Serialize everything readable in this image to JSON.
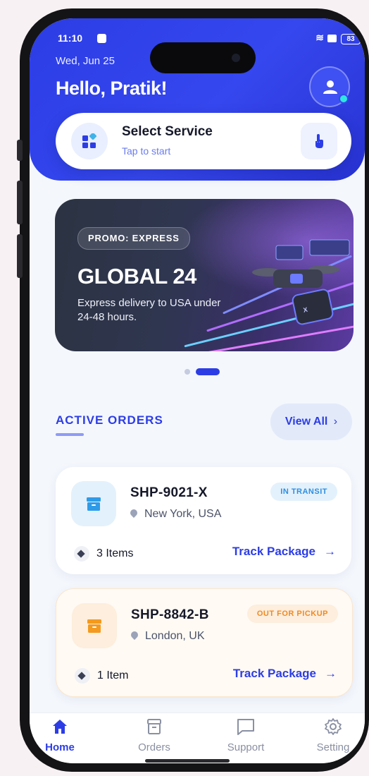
{
  "status_bar": {
    "time": "11:10",
    "battery": "83"
  },
  "header": {
    "date": "Wed, Jun 25",
    "greeting": "Hello, Pratik!"
  },
  "service": {
    "title": "Select Service",
    "subtitle": "Tap to start"
  },
  "promo": {
    "badge": "PROMO: EXPRESS",
    "title": "GLOBAL 24",
    "description": "Express delivery to USA under 24-48 hours.",
    "slide_count": 2,
    "active_slide": 2
  },
  "orders_section": {
    "title": "ACTIVE ORDERS",
    "view_all": "View All",
    "view_all_icon": "chevron-right-icon"
  },
  "orders": [
    {
      "id": "SHP-9021-X",
      "location": "New York, USA",
      "status": "IN TRANSIT",
      "items": "3 Items",
      "action": "Track Package",
      "accent": "#2e9be8",
      "badge_bg": "#e3f1fc",
      "badge_color": "#2e8fe0"
    },
    {
      "id": "SHP-8842-B",
      "location": "London, UK",
      "status": "OUT FOR PICKUP",
      "items": "1 Item",
      "action": "Track Package",
      "accent": "#f39a1f",
      "badge_bg": "#fdeedd",
      "badge_color": "#f08a22"
    }
  ],
  "tabs": [
    {
      "label": "Home",
      "icon": "home-icon",
      "active": true
    },
    {
      "label": "Orders",
      "icon": "archive-icon",
      "active": false
    },
    {
      "label": "Support",
      "icon": "chat-icon",
      "active": false
    },
    {
      "label": "Setting",
      "icon": "gear-icon",
      "active": false
    }
  ],
  "colors": {
    "primary": "#2c3de6",
    "background": "#f4f7fc"
  }
}
